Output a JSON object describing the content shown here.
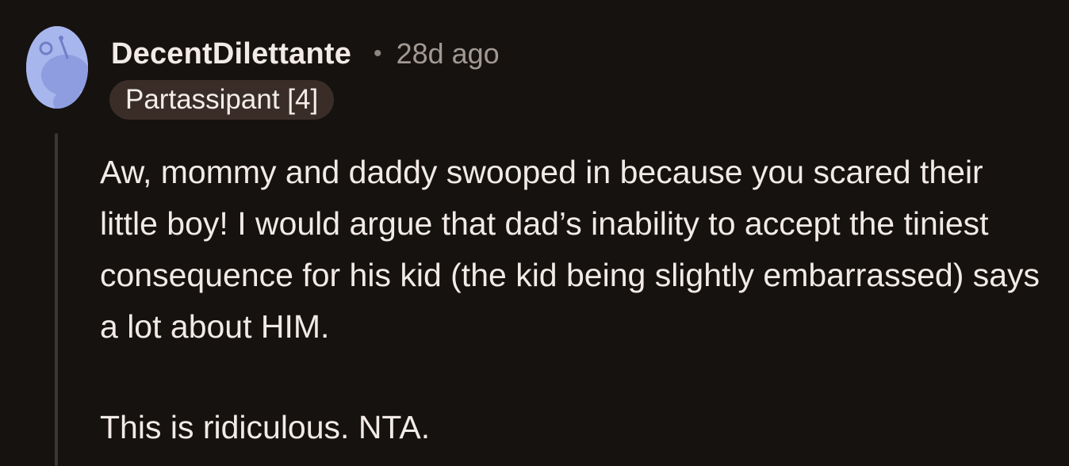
{
  "comment": {
    "author": "DecentDilettante",
    "separator": "•",
    "timestamp": "28d ago",
    "flair": "Partassipant [4]",
    "paragraphs": [
      "Aw, mommy and daddy swooped in because you scared their little boy! I would argue that dad’s inability to accept the tiniest consequence for his kid (the kid being slightly embarrassed) says a lot about HIM.",
      "This is ridiculous. NTA."
    ]
  },
  "colors": {
    "background": "#151210",
    "avatar": "#a8b6ee",
    "flair_bg": "#3a2d27",
    "text": "#f1eae6",
    "muted": "#a39993"
  },
  "icons": {
    "avatar": "snoo-avatar-icon"
  }
}
